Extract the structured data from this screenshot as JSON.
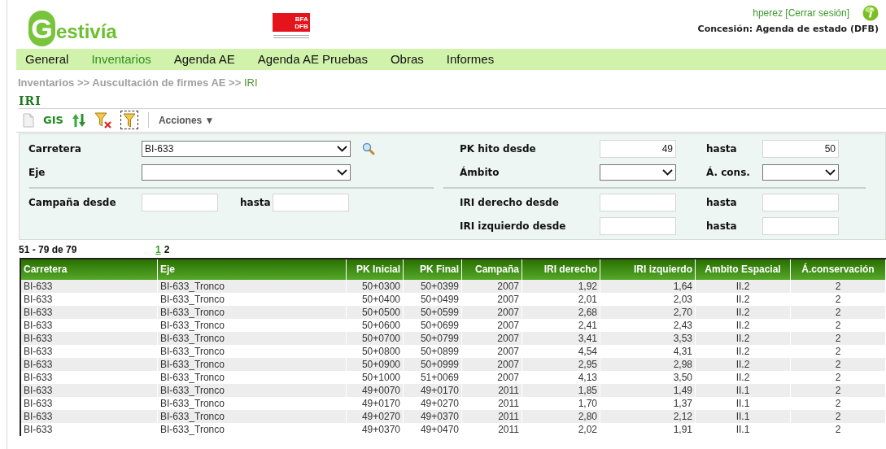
{
  "header": {
    "logo_initial": "G",
    "logo_rest": "estivía",
    "agency_logo": [
      "BFA",
      "DFB"
    ],
    "user": "hperez",
    "logout": "[Cerrar sesión]",
    "concession": "Concesión: Agenda de estado (DFB)"
  },
  "nav": [
    {
      "label": "General",
      "selected": false
    },
    {
      "label": "Inventarios",
      "selected": true
    },
    {
      "label": "Agenda AE",
      "selected": false
    },
    {
      "label": "Agenda AE Pruebas",
      "selected": false
    },
    {
      "label": "Obras",
      "selected": false
    },
    {
      "label": "Informes",
      "selected": false
    }
  ],
  "breadcrumb": {
    "trail": "Inventarios >> Auscultación de firmes AE >>",
    "current": "IRI"
  },
  "page_title": "IRI",
  "toolbar": [
    {
      "kind": "new"
    },
    {
      "kind": "gis",
      "label": "GIS"
    },
    {
      "kind": "sort"
    },
    {
      "kind": "clear_filter"
    },
    {
      "kind": "filter",
      "selected": true
    },
    {
      "kind": "separator"
    },
    {
      "kind": "menu",
      "label": "Acciones ▼"
    }
  ],
  "filters": {
    "left": [
      {
        "kind": "select",
        "label": "Carretera",
        "value": "BI-633",
        "search": true
      },
      {
        "kind": "select",
        "label": "Eje"
      },
      {
        "kind": "divider"
      },
      {
        "kind": "range",
        "label": "Campaña desde",
        "to_label": "hasta"
      },
      {
        "kind": "empty"
      }
    ],
    "right": [
      {
        "kind": "range",
        "label": "PK hito desde",
        "value": "49",
        "to_label": "hasta",
        "to_value": "50"
      },
      {
        "kind": "select_range",
        "label": "Ámbito",
        "to_label": "Á. cons."
      },
      {
        "kind": "divider"
      },
      {
        "kind": "range",
        "label": "IRI derecho desde",
        "to_label": "hasta"
      },
      {
        "kind": "range",
        "label": "IRI izquierdo desde",
        "to_label": "hasta"
      }
    ]
  },
  "pagination": {
    "summary": "51 - 79 de 79",
    "pages": [
      {
        "label": "1",
        "selected": false
      },
      {
        "label": "2",
        "selected": true
      }
    ]
  },
  "table": {
    "columns": [
      "Carretera",
      "Eje",
      "PK Inicial",
      "PK Final",
      "Campaña",
      "IRI derecho",
      "IRI izquierdo",
      "Ambito Espacial",
      "Á.conservación"
    ],
    "rows": [
      [
        "BI-633",
        "BI-633_Tronco",
        "50+0300",
        "50+0399",
        "2007",
        "1,92",
        "1,64",
        "II.2",
        "2"
      ],
      [
        "BI-633",
        "BI-633_Tronco",
        "50+0400",
        "50+0499",
        "2007",
        "2,01",
        "2,03",
        "II.2",
        "2"
      ],
      [
        "BI-633",
        "BI-633_Tronco",
        "50+0500",
        "50+0599",
        "2007",
        "2,68",
        "2,70",
        "II.2",
        "2"
      ],
      [
        "BI-633",
        "BI-633_Tronco",
        "50+0600",
        "50+0699",
        "2007",
        "2,41",
        "2,43",
        "II.2",
        "2"
      ],
      [
        "BI-633",
        "BI-633_Tronco",
        "50+0700",
        "50+0799",
        "2007",
        "3,41",
        "3,53",
        "II.2",
        "2"
      ],
      [
        "BI-633",
        "BI-633_Tronco",
        "50+0800",
        "50+0899",
        "2007",
        "4,54",
        "4,31",
        "II.2",
        "2"
      ],
      [
        "BI-633",
        "BI-633_Tronco",
        "50+0900",
        "50+0999",
        "2007",
        "2,95",
        "2,98",
        "II.2",
        "2"
      ],
      [
        "BI-633",
        "BI-633_Tronco",
        "50+1000",
        "51+0069",
        "2007",
        "4,13",
        "3,50",
        "II.2",
        "2"
      ],
      [
        "BI-633",
        "BI-633_Tronco",
        "49+0070",
        "49+0170",
        "2011",
        "1,85",
        "1,49",
        "II.1",
        "2"
      ],
      [
        "BI-633",
        "BI-633_Tronco",
        "49+0170",
        "49+0270",
        "2011",
        "1,70",
        "1,37",
        "II.1",
        "2"
      ],
      [
        "BI-633",
        "BI-633_Tronco",
        "49+0270",
        "49+0370",
        "2011",
        "2,80",
        "2,12",
        "II.1",
        "2"
      ],
      [
        "BI-633",
        "BI-633_Tronco",
        "49+0370",
        "49+0470",
        "2011",
        "2,02",
        "1,91",
        "II.1",
        "2"
      ]
    ]
  }
}
